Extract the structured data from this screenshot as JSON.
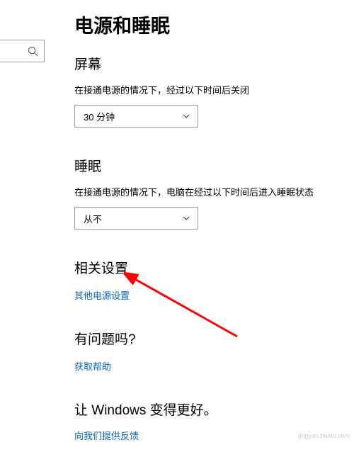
{
  "page_title": "电源和睡眠",
  "screen": {
    "heading": "屏幕",
    "description": "在接通电源的情况下，经过以下时间后关闭",
    "value": "30 分钟"
  },
  "sleep": {
    "heading": "睡眠",
    "description": "在接通电源的情况下，电脑在经过以下时间后进入睡眠状态",
    "value": "从不"
  },
  "related": {
    "heading": "相关设置",
    "link": "其他电源设置"
  },
  "question": {
    "heading": "有问题吗?",
    "link": "获取帮助"
  },
  "better": {
    "heading": "让 Windows 变得更好。",
    "link": "向我们提供反馈"
  },
  "watermark": "jingyan.baidu.com"
}
